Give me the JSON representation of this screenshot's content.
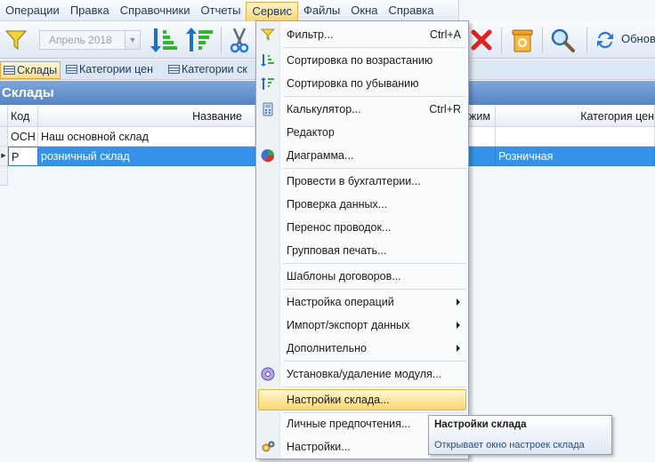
{
  "menubar": {
    "items": [
      "Операции",
      "Правка",
      "Справочники",
      "Отчеты",
      "Сервис",
      "Файлы",
      "Окна",
      "Справка"
    ],
    "active": "Сервис"
  },
  "toolbar": {
    "period": "Апрель 2018",
    "refresh_label": "Обнов"
  },
  "doc_tabs": [
    "Склады",
    "Категории цен",
    "Категории ск"
  ],
  "page": {
    "title": "Склады"
  },
  "grid": {
    "columns": [
      "Код",
      "Название",
      "жим",
      "Категория цен"
    ],
    "rows": [
      {
        "code": "ОСН",
        "name": "Наш основной склад",
        "price_category": ""
      },
      {
        "code": "Р",
        "name": "розничный склад",
        "price_category": "Розничная"
      }
    ]
  },
  "service_menu": {
    "items": [
      {
        "label": "Фильтр...",
        "shortcut": "Ctrl+A",
        "icon": "filter-icon"
      },
      {
        "label": "Сортировка по возрастанию",
        "icon": "sort-ascending-icon"
      },
      {
        "label": "Сортировка по убыванию",
        "icon": "sort-descending-icon"
      },
      {
        "label": "Калькулятор...",
        "shortcut": "Ctrl+R",
        "icon": "calculator-icon"
      },
      {
        "label": "Редактор"
      },
      {
        "label": "Диаграмма...",
        "icon": "pie-chart-icon"
      },
      {
        "label": "Провести в бухгалтерии..."
      },
      {
        "label": "Проверка данных..."
      },
      {
        "label": "Перенос проводок..."
      },
      {
        "label": "Групповая печать..."
      },
      {
        "label": "Шаблоны договоров..."
      },
      {
        "label": "Настройка операций",
        "submenu": true
      },
      {
        "label": "Импорт/экспорт данных",
        "submenu": true
      },
      {
        "label": "Дополнительно",
        "submenu": true
      },
      {
        "label": "Установка/удаление модуля...",
        "icon": "module-install-icon"
      },
      {
        "label": "Настройки склада...",
        "highlighted": true
      },
      {
        "label": "Личные предпочтения..."
      },
      {
        "label": "Настройки...",
        "icon": "settings-gears-icon"
      }
    ]
  },
  "tooltip": {
    "title": "Настройки склада",
    "body": "Открывает окно настроек склада"
  },
  "colors": {
    "accent": "#5584c3",
    "selection": "#3592e8",
    "highlight": "#f9d66f"
  }
}
